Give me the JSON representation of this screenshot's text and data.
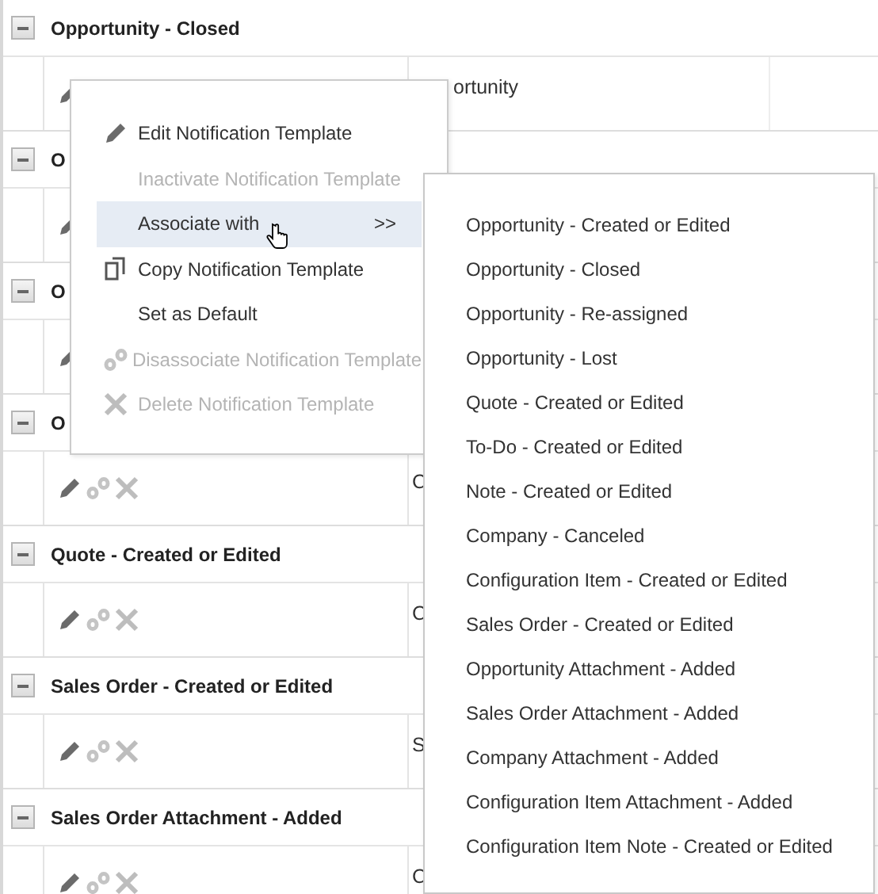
{
  "groups": [
    {
      "title": "Opportunity - Closed",
      "expanded": true,
      "detail": {
        "tools_hidden": true,
        "column_2": "ortunity"
      }
    },
    {
      "title": "O",
      "expanded": true,
      "detail": {
        "tools_hidden": true
      }
    },
    {
      "title": "O",
      "expanded": true,
      "detail": {
        "tools_hidden": true
      }
    },
    {
      "title": "O",
      "expanded": true,
      "detail": {
        "tools_hidden": false,
        "column_2": "C"
      }
    },
    {
      "title": "Quote - Created or Edited",
      "expanded": true,
      "detail": {
        "tools_hidden": false,
        "column_2": "C"
      }
    },
    {
      "title": "Sales Order - Created or Edited",
      "expanded": true,
      "detail": {
        "tools_hidden": false,
        "column_2": "S"
      }
    },
    {
      "title": "Sales Order Attachment - Added",
      "expanded": true,
      "detail": {
        "tools_hidden": false,
        "column_2": "C"
      }
    }
  ],
  "context_menu": {
    "items": [
      {
        "label": "Edit Notification Template",
        "kind": "edit",
        "disabled": false,
        "selected": false
      },
      {
        "label": "Inactivate Notification Template",
        "kind": "plain",
        "disabled": true,
        "selected": false
      },
      {
        "label": "Associate with",
        "kind": "plain",
        "disabled": false,
        "selected": true,
        "submenu_mark": ">>"
      },
      {
        "label": "Copy Notification Template",
        "kind": "copy",
        "disabled": false,
        "selected": false
      },
      {
        "label": "Set as Default",
        "kind": "plain",
        "disabled": false,
        "selected": false
      },
      {
        "label": "Disassociate Notification Template",
        "kind": "disassociate",
        "disabled": true,
        "selected": false
      },
      {
        "label": "Delete Notification Template",
        "kind": "delete",
        "disabled": true,
        "selected": false
      }
    ]
  },
  "submenu": {
    "items": [
      "Opportunity - Created or Edited",
      "Opportunity - Closed",
      "Opportunity - Re-assigned",
      "Opportunity - Lost",
      "Quote - Created or Edited",
      "To-Do - Created or Edited",
      "Note - Created or Edited",
      "Company - Canceled",
      "Configuration Item - Created or Edited",
      "Sales Order - Created or Edited",
      "Opportunity Attachment - Added",
      "Sales Order Attachment - Added",
      "Company Attachment - Added",
      "Configuration Item Attachment - Added",
      "Configuration Item Note - Created or Edited"
    ]
  }
}
